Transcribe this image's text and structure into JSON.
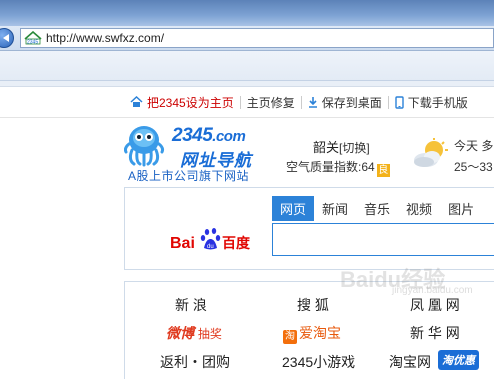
{
  "browser": {
    "url": "http://www.swfxz.com/",
    "favicon": "2345-favicon"
  },
  "toplinks": {
    "set_home": "把2345设为主页",
    "repair": "主页修复",
    "save_desktop": "保存到桌面",
    "download_mobile": "下载手机版"
  },
  "logo": {
    "brand": "2345",
    "brand_suffix": ".com",
    "name_cn": "网址导航",
    "subtitle": "A股上市公司旗下网站"
  },
  "weather": {
    "city": "韶关",
    "switch_label": "[切换]",
    "air_quality_label": "空气质量指数:64",
    "air_quality_badge": "良",
    "today": "今天 多",
    "temperature": "25～33"
  },
  "search": {
    "tabs": [
      "网页",
      "新闻",
      "音乐",
      "视频",
      "图片"
    ],
    "active_tab": "网页",
    "engine": "Bai百度",
    "engine_logo": "baidu-logo"
  },
  "sites": {
    "row1": [
      "新 浪",
      "搜 狐",
      "凤 凰 网"
    ],
    "weibo": "微博",
    "weibo_sub": "抽奖",
    "aitaobao_mark": "淘",
    "aitaobao": "爱淘宝",
    "xinhua": "新 华 网",
    "fanli": "返利・团购",
    "game": "2345小游戏",
    "taobao": "淘宝网",
    "youhui": "淘优惠"
  },
  "watermark": "Baidu经验",
  "watermark_sub": "jingyan.baidu.com",
  "colors": {
    "accent_blue": "#2c82d8",
    "brand_blue": "#1a6dd6",
    "home_red": "#cc0000",
    "weibo_red": "#e03a1f",
    "taobao_orange": "#f36f0c"
  }
}
